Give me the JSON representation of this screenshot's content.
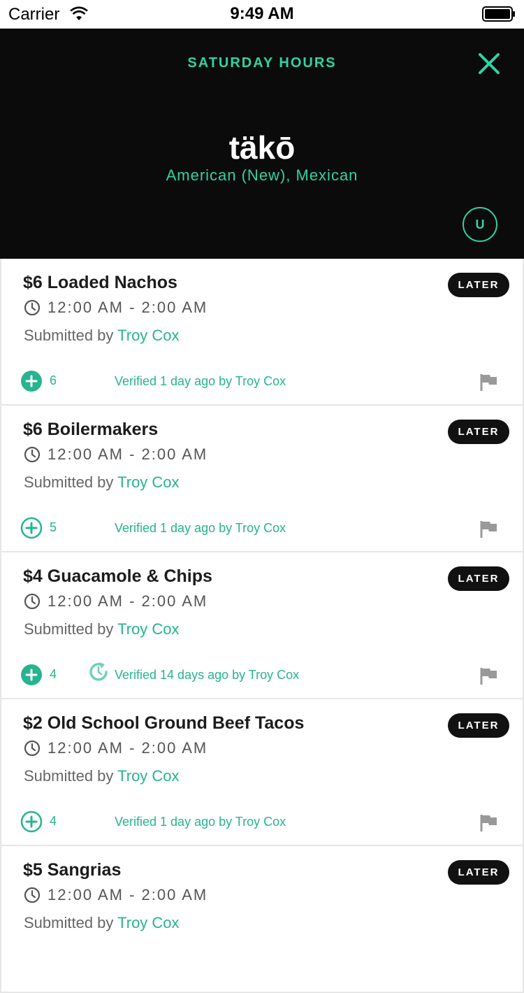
{
  "status_bar": {
    "carrier": "Carrier",
    "time": "9:49 AM"
  },
  "header": {
    "title": "SATURDAY HOURS",
    "venue_name": "täkō",
    "cuisine": "American (New), Mexican",
    "avatar_initial": "U"
  },
  "colors": {
    "accent": "#2fd3a4",
    "header_bg": "#0b0b0b",
    "badge_bg": "#111111"
  },
  "deals": [
    {
      "title": "$6 Loaded Nachos",
      "hours": "12:00 AM - 2:00 AM",
      "submitted_prefix": "Submitted by",
      "submitter": "Troy Cox",
      "badge": "LATER",
      "votes": "6",
      "verified": "Verified 1 day ago by Troy Cox",
      "vote_filled": true,
      "stale": false
    },
    {
      "title": "$6 Boilermakers",
      "hours": "12:00 AM - 2:00 AM",
      "submitted_prefix": "Submitted by",
      "submitter": "Troy Cox",
      "badge": "LATER",
      "votes": "5",
      "verified": "Verified 1 day ago by Troy Cox",
      "vote_filled": false,
      "stale": false
    },
    {
      "title": "$4 Guacamole & Chips",
      "hours": "12:00 AM - 2:00 AM",
      "submitted_prefix": "Submitted by",
      "submitter": "Troy Cox",
      "badge": "LATER",
      "votes": "4",
      "verified": "Verified 14 days ago by Troy Cox",
      "vote_filled": true,
      "stale": true
    },
    {
      "title": "$2 Old School Ground Beef Tacos",
      "hours": "12:00 AM - 2:00 AM",
      "submitted_prefix": "Submitted by",
      "submitter": "Troy Cox",
      "badge": "LATER",
      "votes": "4",
      "verified": "Verified 1 day ago by Troy Cox",
      "vote_filled": false,
      "stale": false
    },
    {
      "title": "$5 Sangrias",
      "hours": "12:00 AM - 2:00 AM",
      "submitted_prefix": "Submitted by",
      "submitter": "Troy Cox",
      "badge": "LATER",
      "votes": "",
      "verified": "",
      "vote_filled": false,
      "stale": false
    }
  ]
}
